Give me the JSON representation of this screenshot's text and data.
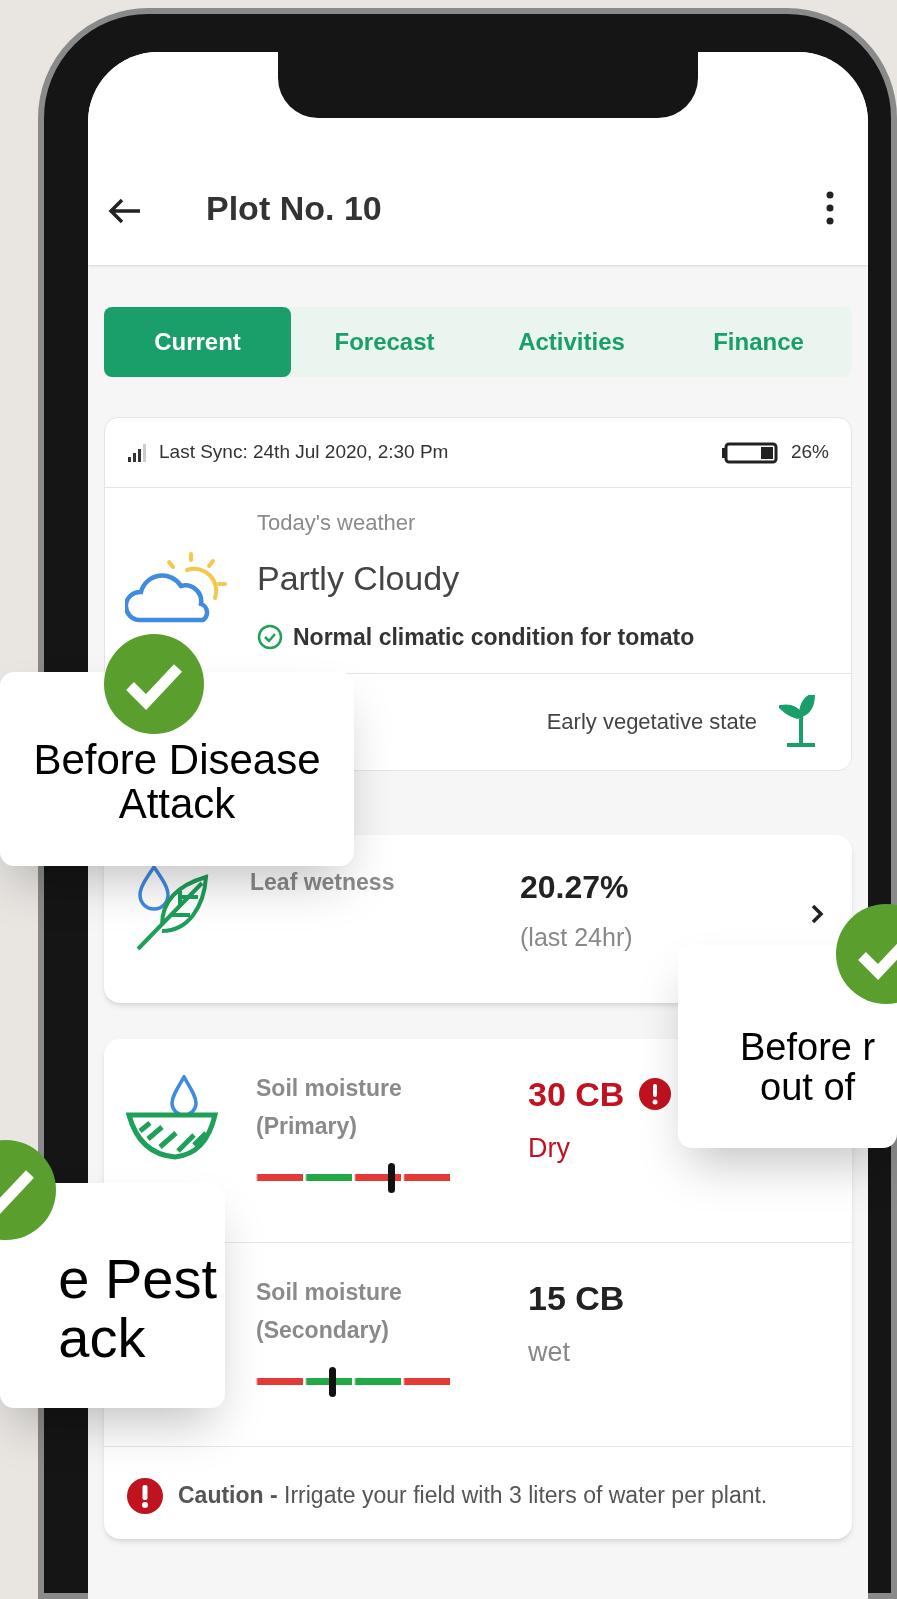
{
  "header": {
    "title": "Plot No. 10"
  },
  "tabs": [
    {
      "label": "Current",
      "selected": true
    },
    {
      "label": "Forecast",
      "selected": false
    },
    {
      "label": "Activities",
      "selected": false
    },
    {
      "label": "Finance",
      "selected": false
    }
  ],
  "sync_card": {
    "last_sync": "Last Sync: 24th Jul 2020, 2:30 Pm",
    "battery": "26%",
    "weather_label": "Today's weather",
    "weather": "Partly Cloudy",
    "status": "Normal climatic condition for tomato",
    "crop_stage": "Early vegetative state"
  },
  "leaf_wetness": {
    "label": "Leaf wetness",
    "value": "20.27%",
    "note": "(last 24hr)"
  },
  "soil_moisture": [
    {
      "label": "Soil moisture (Primary)",
      "value": "30 CB",
      "state": "Dry",
      "alert": true,
      "level": 0.69,
      "segments": [
        {
          "color": "#e53935"
        },
        {
          "color": "#22a844"
        },
        {
          "color": "#e53935"
        },
        {
          "color": "#e53935"
        }
      ]
    },
    {
      "label": "Soil moisture (Secondary)",
      "value": "15 CB",
      "state": "wet",
      "alert": false,
      "level": 0.39,
      "segments": [
        {
          "color": "#e53935"
        },
        {
          "color": "#22a844"
        },
        {
          "color": "#22a844"
        },
        {
          "color": "#e53935"
        }
      ]
    }
  ],
  "caution": {
    "text": "**Caution -** Irrigate your field with 3 liters of water per plant."
  },
  "callouts": [
    {
      "lines": [
        "Before Disease",
        "Attack"
      ]
    },
    {
      "lines": [
        "Before r",
        "out of"
      ]
    },
    {
      "lines": [
        "e Pest",
        "ack"
      ]
    }
  ]
}
